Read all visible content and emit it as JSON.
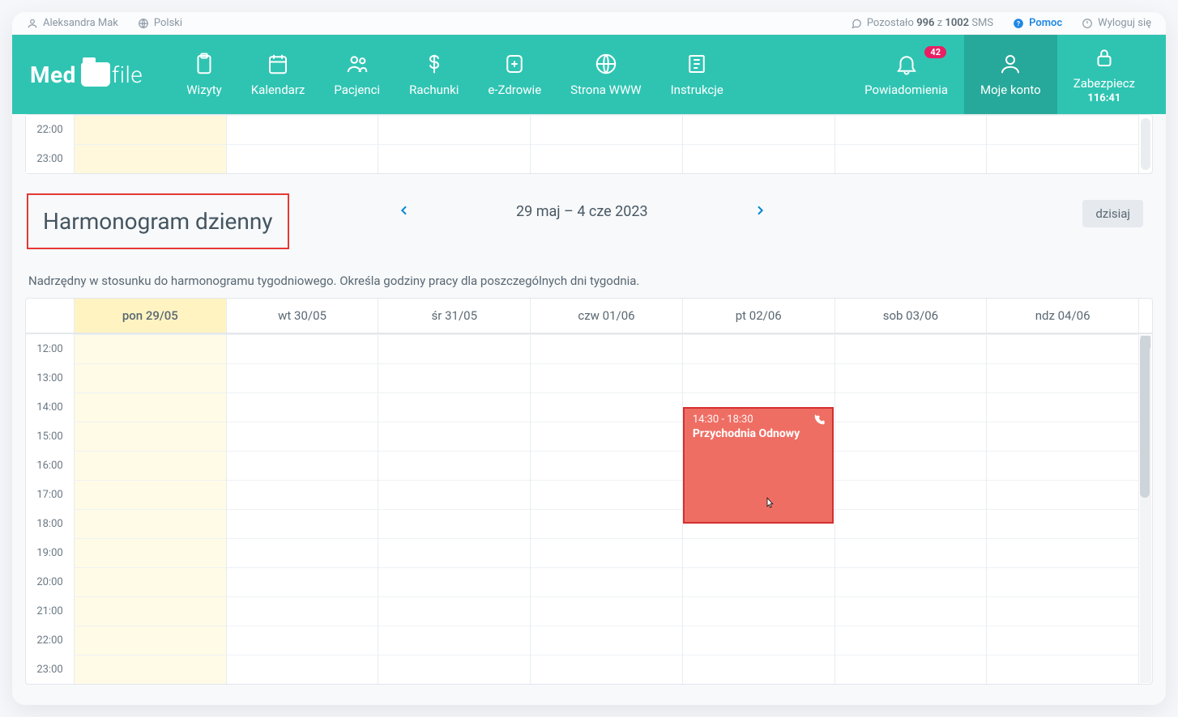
{
  "topbar": {
    "user": "Aleksandra Mak",
    "language": "Polski",
    "sms_prefix": "Pozostało ",
    "sms_remaining": "996",
    "sms_mid": " z ",
    "sms_total": "1002",
    "sms_suffix": " SMS",
    "help": "Pomoc",
    "logout": "Wyloguj się"
  },
  "logo": {
    "part1": "Med",
    "part2": "file"
  },
  "nav": {
    "items": [
      {
        "label": "Wizyty"
      },
      {
        "label": "Kalendarz"
      },
      {
        "label": "Pacjenci"
      },
      {
        "label": "Rachunki"
      },
      {
        "label": "e-Zdrowie"
      },
      {
        "label": "Strona WWW"
      },
      {
        "label": "Instrukcje"
      }
    ],
    "right": {
      "notifications": {
        "label": "Powiadomienia",
        "badge": "42"
      },
      "account": {
        "label": "Moje konto"
      },
      "lock": {
        "label": "Zabezpiecz",
        "timer": "116:41"
      }
    }
  },
  "mini_grid": {
    "rows": [
      "22:00",
      "23:00"
    ]
  },
  "section": {
    "title": "Harmonogram dzienny",
    "range": "29 maj – 4 cze 2023",
    "today_btn": "dzisiaj",
    "description": "Nadrzędny w stosunku do harmonogramu tygodniowego. Określa godziny pracy dla poszczególnych dni tygodnia."
  },
  "calendar": {
    "days": [
      {
        "label": "pon 29/05",
        "today": true
      },
      {
        "label": "wt 30/05"
      },
      {
        "label": "śr 31/05"
      },
      {
        "label": "czw 01/06"
      },
      {
        "label": "pt 02/06"
      },
      {
        "label": "sob 03/06"
      },
      {
        "label": "ndz 04/06"
      }
    ],
    "hours": [
      "12:00",
      "13:00",
      "14:00",
      "15:00",
      "16:00",
      "17:00",
      "18:00",
      "19:00",
      "20:00",
      "21:00",
      "22:00",
      "23:00"
    ],
    "event": {
      "time": "14:30 - 18:30",
      "title": "Przychodnia Odnowy"
    }
  }
}
